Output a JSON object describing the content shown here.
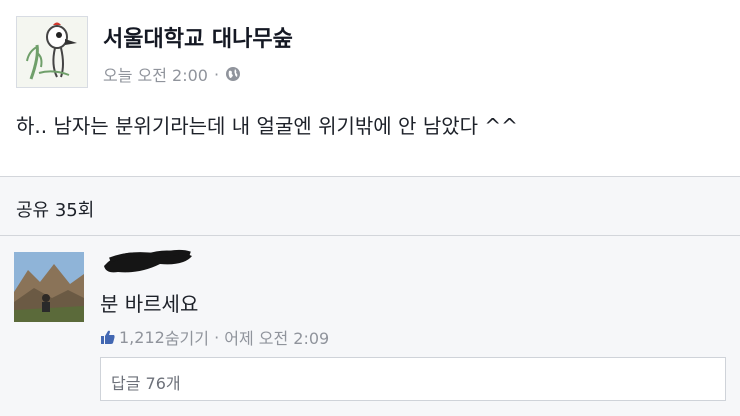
{
  "post": {
    "page_name": "서울대학교 대나무숲",
    "timestamp": "오늘 오전 2:00",
    "separator": "·",
    "privacy_icon": "globe-icon",
    "text": "하.. 남자는 분위기라는데 내 얼굴엔 위기밖에 안 남았다 ^^"
  },
  "shares": {
    "label": "공유 35회"
  },
  "comment": {
    "text": "분 바르세요",
    "like_icon": "thumbs-up-icon",
    "likes_text": "1,212",
    "hide_label": "숨기기",
    "separator": " · ",
    "time": "어제 오전 2:09",
    "reply_box_label": "답글 76개"
  },
  "colors": {
    "background": "#ffffff",
    "share_bar": "#f6f7f9",
    "meta_text": "#90949c",
    "like_blue": "#4267b2"
  }
}
